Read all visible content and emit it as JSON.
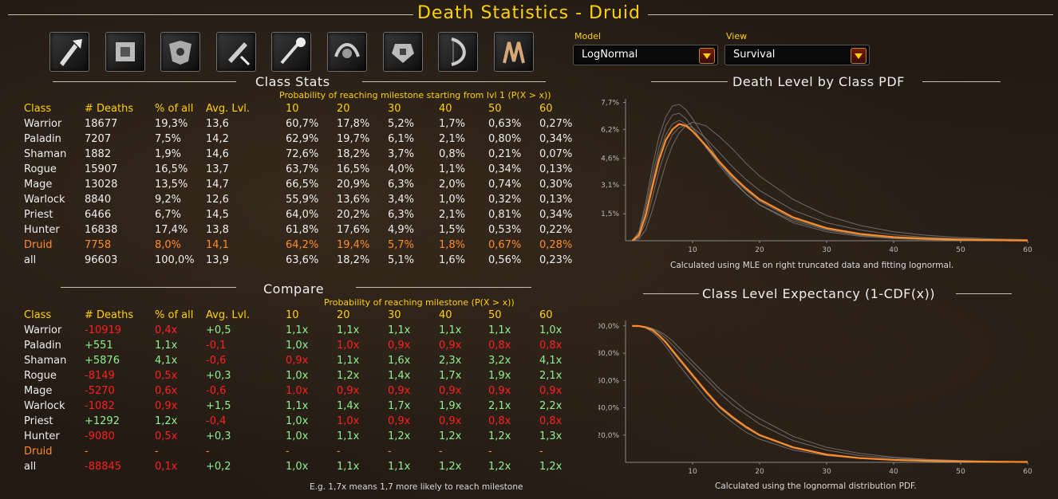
{
  "title": "Death Statistics - Druid",
  "icons": [
    "warrior-class-icon",
    "paladin-class-icon",
    "shaman-class-icon",
    "rogue-class-icon",
    "mage-class-icon",
    "warlock-class-icon",
    "priest-class-icon",
    "hunter-class-icon",
    "druid-class-icon"
  ],
  "controls": {
    "model_label": "Model",
    "model_value": "LogNormal",
    "view_label": "View",
    "view_value": "Survival"
  },
  "class_stats": {
    "heading": "Class Stats",
    "subheading": "Probability of reaching milestone starting from lvl 1 (P(X > x))",
    "columns": [
      "Class",
      "# Deaths",
      "% of all",
      "Avg. Lvl.",
      "10",
      "20",
      "30",
      "40",
      "50",
      "60"
    ],
    "rows": [
      [
        "Warrior",
        "18677",
        "19,3%",
        "13,6",
        "60,7%",
        "17,8%",
        "5,2%",
        "1,7%",
        "0,63%",
        "0,27%"
      ],
      [
        "Paladin",
        "7207",
        "7,5%",
        "14,2",
        "62,9%",
        "19,7%",
        "6,1%",
        "2,1%",
        "0,80%",
        "0,34%"
      ],
      [
        "Shaman",
        "1882",
        "1,9%",
        "14,6",
        "72,6%",
        "18,2%",
        "3,7%",
        "0,8%",
        "0,21%",
        "0,07%"
      ],
      [
        "Rogue",
        "15907",
        "16,5%",
        "13,7",
        "63,7%",
        "16,5%",
        "4,0%",
        "1,1%",
        "0,34%",
        "0,13%"
      ],
      [
        "Mage",
        "13028",
        "13,5%",
        "14,7",
        "66,5%",
        "20,9%",
        "6,3%",
        "2,0%",
        "0,74%",
        "0,30%"
      ],
      [
        "Warlock",
        "8840",
        "9,2%",
        "12,6",
        "55,9%",
        "13,6%",
        "3,4%",
        "1,0%",
        "0,32%",
        "0,13%"
      ],
      [
        "Priest",
        "6466",
        "6,7%",
        "14,5",
        "64,0%",
        "20,2%",
        "6,3%",
        "2,1%",
        "0,81%",
        "0,34%"
      ],
      [
        "Hunter",
        "16838",
        "17,4%",
        "13,8",
        "61,8%",
        "17,6%",
        "4,9%",
        "1,5%",
        "0,53%",
        "0,22%"
      ],
      [
        "Druid",
        "7758",
        "8,0%",
        "14,1",
        "64,2%",
        "19,4%",
        "5,7%",
        "1,8%",
        "0,67%",
        "0,28%"
      ],
      [
        "all",
        "96603",
        "100,0%",
        "13,9",
        "63,6%",
        "18,2%",
        "5,1%",
        "1,6%",
        "0,56%",
        "0,23%"
      ]
    ],
    "highlight_row": 8
  },
  "compare": {
    "heading": "Compare",
    "subheading": "Probability of reaching milestone (P(X > x))",
    "columns": [
      "Class",
      "# Deaths",
      "% of all",
      "Avg. Lvl.",
      "10",
      "20",
      "30",
      "40",
      "50",
      "60"
    ],
    "rows": [
      [
        "Warrior",
        "-10919",
        "0,4x",
        "+0,5",
        "1,1x",
        "1,1x",
        "1,1x",
        "1,1x",
        "1,1x",
        "1,0x"
      ],
      [
        "Paladin",
        "+551",
        "1,1x",
        "-0,1",
        "1,0x",
        "1,0x",
        "0,9x",
        "0,9x",
        "0,8x",
        "0,8x"
      ],
      [
        "Shaman",
        "+5876",
        "4,1x",
        "-0,6",
        "0,9x",
        "1,1x",
        "1,6x",
        "2,3x",
        "3,2x",
        "4,1x"
      ],
      [
        "Rogue",
        "-8149",
        "0,5x",
        "+0,3",
        "1,0x",
        "1,2x",
        "1,4x",
        "1,7x",
        "1,9x",
        "2,1x"
      ],
      [
        "Mage",
        "-5270",
        "0,6x",
        "-0,6",
        "1,0x",
        "0,9x",
        "0,9x",
        "0,9x",
        "0,9x",
        "0,9x"
      ],
      [
        "Warlock",
        "-1082",
        "0,9x",
        "+1,5",
        "1,1x",
        "1,4x",
        "1,7x",
        "1,9x",
        "2,1x",
        "2,2x"
      ],
      [
        "Priest",
        "+1292",
        "1,2x",
        "-0,4",
        "1,0x",
        "1,0x",
        "0,9x",
        "0,9x",
        "0,8x",
        "0,8x"
      ],
      [
        "Hunter",
        "-9080",
        "0,5x",
        "+0,3",
        "1,0x",
        "1,1x",
        "1,2x",
        "1,2x",
        "1,2x",
        "1,3x"
      ],
      [
        "Druid",
        "-",
        "-",
        "-",
        "-",
        "-",
        "-",
        "-",
        "-",
        "-"
      ],
      [
        "all",
        "-88845",
        "0,1x",
        "+0,2",
        "1,0x",
        "1,1x",
        "1,1x",
        "1,2x",
        "1,2x",
        "1,2x"
      ]
    ],
    "colors": [
      [
        "w",
        "r",
        "r",
        "g",
        "g",
        "g",
        "g",
        "g",
        "g",
        "g"
      ],
      [
        "w",
        "g",
        "g",
        "r",
        "g",
        "r",
        "r",
        "r",
        "r",
        "r"
      ],
      [
        "w",
        "g",
        "g",
        "r",
        "r",
        "g",
        "g",
        "g",
        "g",
        "g"
      ],
      [
        "w",
        "r",
        "r",
        "g",
        "g",
        "g",
        "g",
        "g",
        "g",
        "g"
      ],
      [
        "w",
        "r",
        "r",
        "r",
        "r",
        "r",
        "r",
        "r",
        "r",
        "r"
      ],
      [
        "w",
        "r",
        "r",
        "g",
        "g",
        "g",
        "g",
        "g",
        "g",
        "g"
      ],
      [
        "w",
        "g",
        "g",
        "r",
        "g",
        "r",
        "r",
        "r",
        "r",
        "r"
      ],
      [
        "w",
        "r",
        "r",
        "g",
        "g",
        "g",
        "g",
        "g",
        "g",
        "g"
      ],
      [
        "o",
        "o",
        "o",
        "o",
        "o",
        "o",
        "o",
        "o",
        "o",
        "o"
      ],
      [
        "w",
        "r",
        "r",
        "g",
        "g",
        "g",
        "g",
        "g",
        "g",
        "g"
      ]
    ],
    "note": "E.g. 1,7x means 1,7 more likely to reach milestone"
  },
  "chart_data": [
    {
      "type": "line",
      "title": "Death Level by Class PDF",
      "note": "Calculated using MLE on right truncated data and fitting lognormal.",
      "xlim": [
        0,
        60
      ],
      "ylim": [
        0,
        7.9
      ],
      "xticks": [
        10,
        20,
        30,
        40,
        50,
        60
      ],
      "yticks": [
        1.5,
        3.1,
        4.6,
        6.2,
        7.7
      ],
      "ytick_labels": [
        "1,5%",
        "3,1%",
        "4,6%",
        "6,2%",
        "7,7%"
      ],
      "x": [
        1,
        2,
        3,
        4,
        5,
        6,
        7,
        8,
        9,
        10,
        12,
        14,
        16,
        18,
        20,
        25,
        30,
        35,
        40,
        45,
        50,
        55,
        60
      ],
      "series": [
        {
          "color": "#ff8c28",
          "values": [
            0.0,
            0.3,
            1.4,
            3.0,
            4.5,
            5.6,
            6.2,
            6.5,
            6.4,
            6.1,
            5.3,
            4.4,
            3.6,
            2.9,
            2.3,
            1.3,
            0.7,
            0.38,
            0.2,
            0.11,
            0.06,
            0.03,
            0.01
          ]
        },
        {
          "color": "#8a8a8a",
          "values": [
            0.0,
            0.4,
            1.8,
            3.6,
            5.2,
            6.4,
            7.0,
            7.1,
            6.8,
            6.3,
            5.2,
            4.2,
            3.3,
            2.6,
            2.0,
            1.1,
            0.6,
            0.3,
            0.15,
            0.08,
            0.04,
            0.02,
            0.01
          ]
        },
        {
          "color": "#8a8a8a",
          "values": [
            0.0,
            0.5,
            2.1,
            4.1,
            5.8,
            6.9,
            7.5,
            7.6,
            7.3,
            6.8,
            5.6,
            4.4,
            3.4,
            2.6,
            2.0,
            1.0,
            0.5,
            0.25,
            0.12,
            0.06,
            0.03,
            0.01,
            0.0
          ]
        },
        {
          "color": "#8a8a8a",
          "values": [
            0.0,
            0.2,
            1.0,
            2.4,
            3.9,
            5.1,
            5.9,
            6.3,
            6.4,
            6.3,
            5.7,
            4.9,
            4.1,
            3.4,
            2.8,
            1.7,
            1.0,
            0.6,
            0.33,
            0.19,
            0.11,
            0.06,
            0.03
          ]
        },
        {
          "color": "#8a8a8a",
          "values": [
            0.0,
            0.3,
            1.5,
            3.2,
            4.8,
            5.9,
            6.5,
            6.7,
            6.5,
            6.1,
            5.2,
            4.3,
            3.5,
            2.8,
            2.2,
            1.2,
            0.65,
            0.35,
            0.18,
            0.1,
            0.05,
            0.03,
            0.01
          ]
        },
        {
          "color": "#8a8a8a",
          "values": [
            0.0,
            0.1,
            0.6,
            1.7,
            3.0,
            4.3,
            5.3,
            6.0,
            6.4,
            6.6,
            6.4,
            5.8,
            5.1,
            4.3,
            3.6,
            2.3,
            1.4,
            0.85,
            0.5,
            0.3,
            0.18,
            0.1,
            0.06
          ]
        }
      ]
    },
    {
      "type": "line",
      "title": "Class Level Expectancy (1-CDF(x))",
      "note": "Calculated using the lognormal distribution PDF.",
      "xlim": [
        0,
        60
      ],
      "ylim": [
        0,
        104
      ],
      "xticks": [
        10,
        20,
        30,
        40,
        50,
        60
      ],
      "yticks": [
        20,
        40,
        60,
        80,
        100
      ],
      "ytick_labels": [
        "20,0%",
        "40,0%",
        "60,0%",
        "80,0%",
        "100,0%"
      ],
      "x": [
        1,
        2,
        3,
        4,
        5,
        6,
        7,
        8,
        9,
        10,
        12,
        14,
        16,
        18,
        20,
        25,
        30,
        35,
        40,
        45,
        50,
        55,
        60
      ],
      "series": [
        {
          "color": "#ff8c28",
          "values": [
            100,
            99.9,
            99,
            97,
            93,
            88,
            82,
            76,
            70,
            64,
            52,
            41,
            33,
            26,
            20,
            11,
            5.7,
            3.1,
            1.8,
            1.1,
            0.7,
            0.4,
            0.28
          ]
        },
        {
          "color": "#8a8a8a",
          "values": [
            100,
            99.8,
            98.5,
            95.5,
            91,
            85,
            78,
            71,
            65,
            59,
            47,
            37,
            29,
            22,
            17,
            9,
            5,
            2.8,
            1.6,
            0.9,
            0.5,
            0.3,
            0.2
          ]
        },
        {
          "color": "#8a8a8a",
          "values": [
            100,
            99.9,
            99.3,
            97.8,
            95,
            91,
            86,
            81,
            76,
            71,
            61,
            51,
            42,
            35,
            28,
            16,
            9,
            5,
            3,
            1.8,
            1.1,
            0.6,
            0.4
          ]
        },
        {
          "color": "#8a8a8a",
          "values": [
            100,
            99.9,
            99.1,
            96.9,
            93,
            87.5,
            81,
            75,
            69,
            63,
            51,
            40,
            32,
            25,
            19.5,
            10.5,
            5.5,
            3,
            1.7,
            1,
            0.6,
            0.35,
            0.2
          ]
        },
        {
          "color": "#8a8a8a",
          "values": [
            100,
            99.9,
            99.4,
            98.2,
            96,
            93,
            89,
            84,
            79,
            74,
            64,
            54,
            46,
            38,
            32,
            19,
            11,
            6.5,
            3.8,
            2.2,
            1.3,
            0.8,
            0.5
          ]
        }
      ]
    }
  ]
}
